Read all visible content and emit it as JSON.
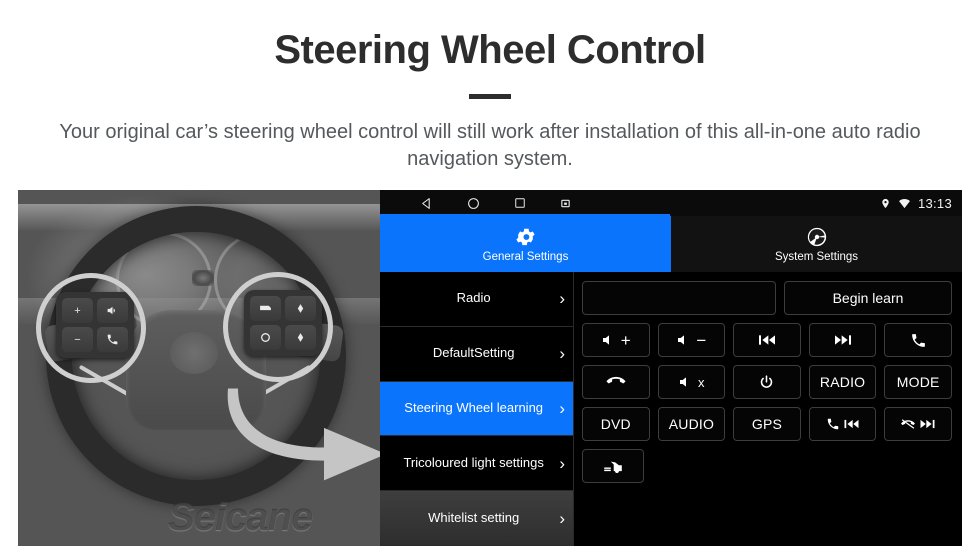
{
  "header": {
    "title": "Steering Wheel Control",
    "subtitle": "Your original car’s steering wheel control will still work after installation of this all-in-one auto radio navigation system."
  },
  "photo": {
    "watermark": "Seicane",
    "highlight_color": "#ffd21e",
    "arrow_color": "#f5c728",
    "left_pad_keys": [
      "+",
      "voice-icon",
      "−",
      "call-icon"
    ],
    "right_pad_keys": [
      "display-icon",
      "up-icon",
      "circle-icon",
      "down-icon"
    ]
  },
  "headunit": {
    "statusbar": {
      "nav_back": "back-icon",
      "nav_home": "home-icon",
      "nav_recents": "recents-icon",
      "nav_screenshot": "screenshot-icon",
      "location_icon": "location-pin-icon",
      "wifi_icon": "wifi-icon",
      "clock": "13:13",
      "accent_color": "#0a74fd"
    },
    "tabs": [
      {
        "label": "General Settings",
        "icon": "gear-icon",
        "active": true
      },
      {
        "label": "System Settings",
        "icon": "aperture-swirl-icon",
        "active": false
      }
    ],
    "menu": [
      {
        "label": "Radio",
        "state": "normal"
      },
      {
        "label": "DefaultSetting",
        "state": "normal"
      },
      {
        "label": "Steering Wheel learning",
        "state": "selected"
      },
      {
        "label": "Tricoloured light settings",
        "state": "normal"
      },
      {
        "label": "Whitelist setting",
        "state": "hover"
      }
    ],
    "chevron": "›",
    "panel": {
      "input_value": "",
      "input_placeholder": "",
      "begin_learn_label": "Begin learn",
      "rows": [
        [
          {
            "name": "volume-up",
            "icon": "speaker-icon",
            "sign": "+",
            "label": ""
          },
          {
            "name": "volume-down",
            "icon": "speaker-icon",
            "sign": "−",
            "label": ""
          },
          {
            "name": "previous-track",
            "icon": "prev-track-icon",
            "sign": "",
            "label": ""
          },
          {
            "name": "next-track",
            "icon": "next-track-icon",
            "sign": "",
            "label": ""
          },
          {
            "name": "call-answer",
            "icon": "phone-icon",
            "sign": "",
            "label": ""
          }
        ],
        [
          {
            "name": "call-hangup",
            "icon": "phone-hangup-icon",
            "sign": "",
            "label": ""
          },
          {
            "name": "mute",
            "icon": "speaker-icon",
            "sign": "x",
            "label": ""
          },
          {
            "name": "power",
            "icon": "power-icon",
            "sign": "",
            "label": ""
          },
          {
            "name": "radio",
            "icon": "",
            "sign": "",
            "label": "RADIO"
          },
          {
            "name": "mode",
            "icon": "",
            "sign": "",
            "label": "MODE"
          }
        ],
        [
          {
            "name": "dvd",
            "icon": "",
            "sign": "",
            "label": "DVD"
          },
          {
            "name": "audio",
            "icon": "",
            "sign": "",
            "label": "AUDIO"
          },
          {
            "name": "gps",
            "icon": "",
            "sign": "",
            "label": "GPS"
          },
          {
            "name": "call-previous",
            "icon": "phone-prev-icon",
            "sign": "",
            "label": ""
          },
          {
            "name": "hangup-next",
            "icon": "hangup-next-icon",
            "sign": "",
            "label": ""
          }
        ],
        [
          {
            "name": "car-settings",
            "icon": "car-icon",
            "sign": "",
            "label": ""
          }
        ]
      ]
    }
  }
}
